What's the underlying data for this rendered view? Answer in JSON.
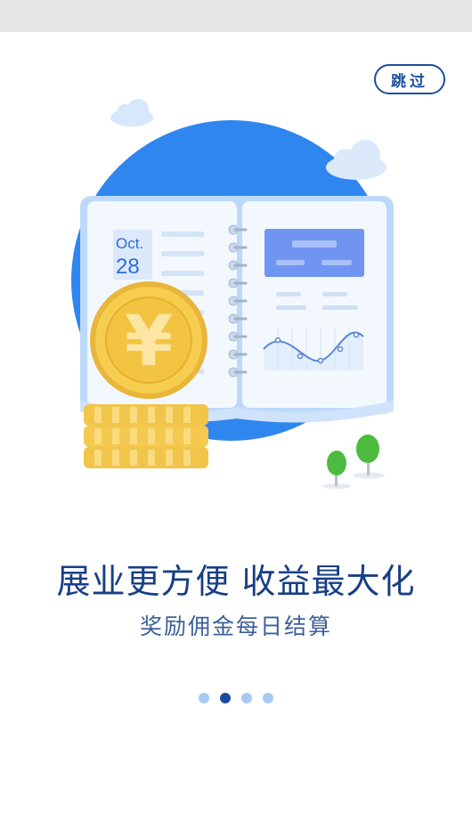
{
  "skip": {
    "label": "跳过"
  },
  "calendar": {
    "month": "Oct.",
    "day": "28"
  },
  "coin": {
    "symbol": "¥"
  },
  "headline": {
    "title": "展业更方便 收益最大化",
    "subtitle": "奖励佣金每日结算"
  },
  "pager": {
    "pages": 4,
    "active_index": 1
  },
  "colors": {
    "primary_blue": "#1b4f9c",
    "circle_blue": "#2f86ee",
    "coin_gold": "#f5c84a",
    "dot_inactive": "#a6c9f3",
    "dot_active": "#1a4c9f"
  }
}
